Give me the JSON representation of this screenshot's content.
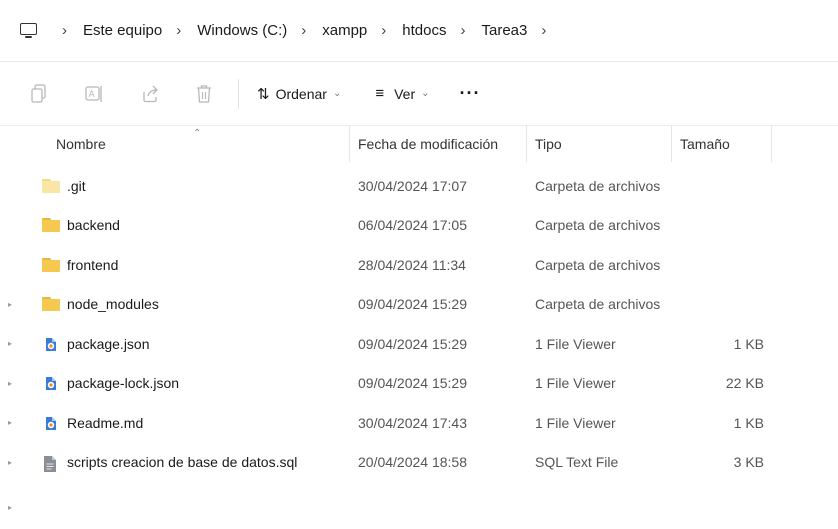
{
  "breadcrumb": {
    "items": [
      "Este equipo",
      "Windows (C:)",
      "xampp",
      "htdocs",
      "Tarea3"
    ],
    "icon": "computer-icon"
  },
  "toolbar": {
    "icons": [
      "copy-icon",
      "rename-icon",
      "share-icon",
      "delete-icon"
    ],
    "sort_label": "Ordenar",
    "view_label": "Ver",
    "more_label": "···"
  },
  "columns": {
    "name": "Nombre",
    "date": "Fecha de modificación",
    "type": "Tipo",
    "size": "Tamaño"
  },
  "files": [
    {
      "name": ".git",
      "date": "30/04/2024 17:07",
      "type": "Carpeta de archivos",
      "size": "",
      "icon": "folder-faded-icon",
      "expander": false
    },
    {
      "name": "backend",
      "date": "06/04/2024 17:05",
      "type": "Carpeta de archivos",
      "size": "",
      "icon": "folder-icon",
      "expander": false
    },
    {
      "name": "frontend",
      "date": "28/04/2024 11:34",
      "type": "Carpeta de archivos",
      "size": "",
      "icon": "folder-icon",
      "expander": false
    },
    {
      "name": "node_modules",
      "date": "09/04/2024 15:29",
      "type": "Carpeta de archivos",
      "size": "",
      "icon": "folder-icon",
      "expander": true
    },
    {
      "name": "package.json",
      "date": "09/04/2024 15:29",
      "type": "1 File Viewer",
      "size": "1 KB",
      "icon": "file-viewer-icon",
      "expander": true
    },
    {
      "name": "package-lock.json",
      "date": "09/04/2024 15:29",
      "type": "1 File Viewer",
      "size": "22 KB",
      "icon": "file-viewer-icon",
      "expander": true
    },
    {
      "name": "Readme.md",
      "date": "30/04/2024 17:43",
      "type": "1 File Viewer",
      "size": "1 KB",
      "icon": "file-viewer-icon",
      "expander": true
    },
    {
      "name": "scripts creacion de base de datos.sql",
      "date": "20/04/2024 18:58",
      "type": "SQL Text File",
      "size": "3 KB",
      "icon": "sql-file-icon",
      "expander": true
    }
  ],
  "colors": {
    "folder": "#f5c94f",
    "folder_faded": "#f8e6a4",
    "viewer_blue": "#3a7bd5",
    "viewer_orange": "#f08a24"
  }
}
